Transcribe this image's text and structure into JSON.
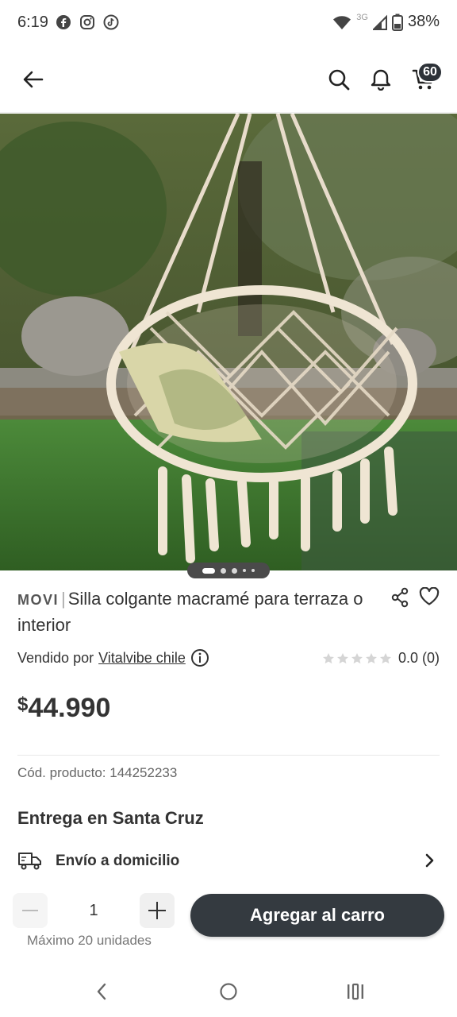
{
  "status_bar": {
    "time": "6:19",
    "network": "3G",
    "battery": "38%",
    "icons": [
      "facebook-icon",
      "instagram-icon",
      "tiktok-icon",
      "wifi-icon",
      "signal-icon",
      "battery-icon"
    ]
  },
  "header": {
    "cart_count": "60",
    "icons": [
      "back-arrow-icon",
      "search-icon",
      "bell-icon",
      "cart-icon"
    ]
  },
  "carousel": {
    "slide_count": 5,
    "active_index": 0
  },
  "product": {
    "brand": "MOVI",
    "separator": "|",
    "title": "Silla colgante macramé para terraza o interior",
    "seller_prefix": "Vendido por",
    "seller_name": "Vitalvibe chile",
    "rating_text": "0.0 (0)",
    "rating_stars": 0,
    "price_symbol": "$",
    "price": "44.990",
    "sku": "Cód. producto: 144252233"
  },
  "delivery": {
    "title": "Entrega en Santa Cruz",
    "option_label": "Envío a domicilio"
  },
  "purchase": {
    "quantity": "1",
    "max_units": "Máximo 20 unidades",
    "add_to_cart_label": "Agregar al carro"
  },
  "colors": {
    "primary_dark": "#343a40",
    "text": "#333333",
    "muted": "#777777",
    "star_empty": "#d5d5d5"
  }
}
